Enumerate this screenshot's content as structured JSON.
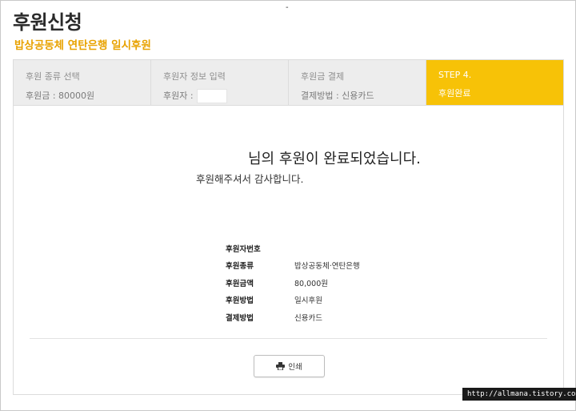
{
  "top_mark": "-",
  "page": {
    "title": "후원신청",
    "subtitle": "밥상공동체 연탄은행 일시후원"
  },
  "steps": [
    {
      "title": "후원 종류 선택",
      "value": "후원금 : 80000원"
    },
    {
      "title": "후원자 정보 입력",
      "value": "후원자 :"
    },
    {
      "title": "후원금 결제",
      "value": "결제방법 : 신용카드"
    },
    {
      "title": "STEP 4.",
      "value": "후원완료"
    }
  ],
  "message": {
    "title": "님의 후원이 완료되었습니다.",
    "subtitle": "후원해주셔서 감사합니다."
  },
  "details": [
    {
      "label": "후원자번호",
      "value": ""
    },
    {
      "label": "후원종류",
      "value": "밥상공동체·연탄은행"
    },
    {
      "label": "후원금액",
      "value": "80,000원"
    },
    {
      "label": "후원방법",
      "value": "일시후원"
    },
    {
      "label": "결제방법",
      "value": "신용카드"
    }
  ],
  "print_button": {
    "label": "인쇄",
    "icon": "printer-icon"
  },
  "watermark": "http://allmana.tistory.com",
  "colors": {
    "accent": "#f7c207",
    "subtitle": "#e8a200",
    "step_bg": "#ededed"
  }
}
